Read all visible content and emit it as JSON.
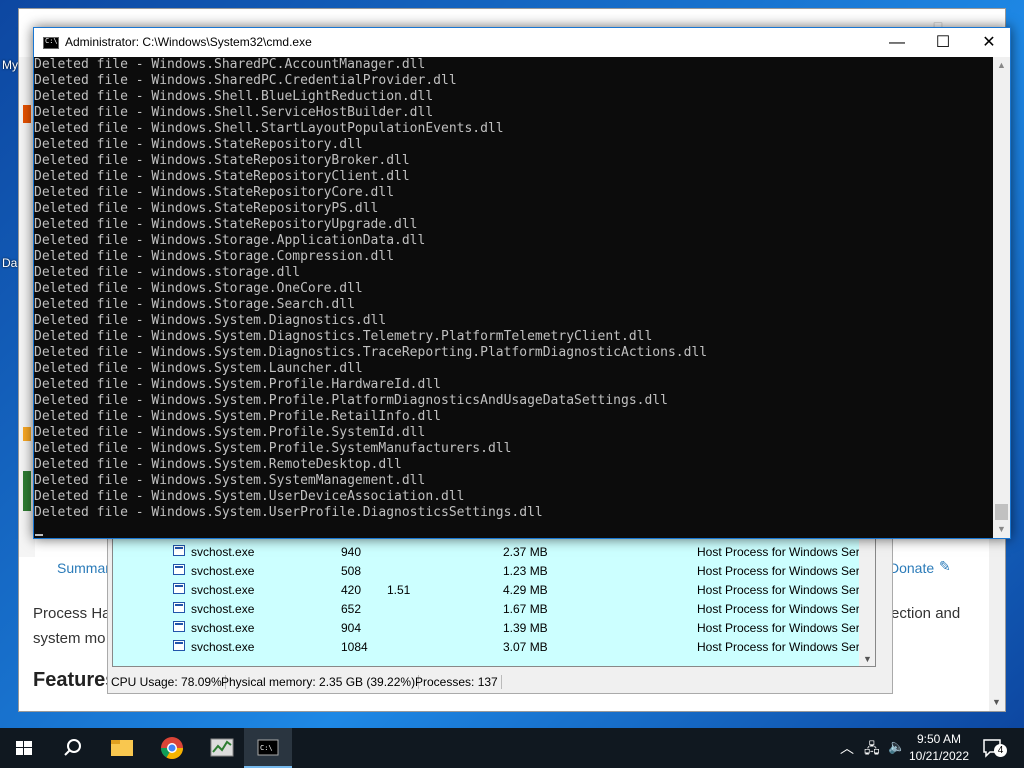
{
  "desktop": {
    "icon_labels": [
      "My",
      "Da"
    ]
  },
  "browser": {
    "summary_link": "Summar",
    "donate_link": "Donate",
    "paragraph_line1": "Process Ha",
    "paragraph_line1_end": "ection and",
    "paragraph_line2": "system mo",
    "features_heading": "Features"
  },
  "cmd": {
    "title": "Administrator:  C:\\Windows\\System32\\cmd.exe",
    "lines": [
      "Deleted file - Windows.SharedPC.AccountManager.dll",
      "Deleted file - Windows.SharedPC.CredentialProvider.dll",
      "Deleted file - Windows.Shell.BlueLightReduction.dll",
      "Deleted file - Windows.Shell.ServiceHostBuilder.dll",
      "Deleted file - Windows.Shell.StartLayoutPopulationEvents.dll",
      "Deleted file - Windows.StateRepository.dll",
      "Deleted file - Windows.StateRepositoryBroker.dll",
      "Deleted file - Windows.StateRepositoryClient.dll",
      "Deleted file - Windows.StateRepositoryCore.dll",
      "Deleted file - Windows.StateRepositoryPS.dll",
      "Deleted file - Windows.StateRepositoryUpgrade.dll",
      "Deleted file - Windows.Storage.ApplicationData.dll",
      "Deleted file - Windows.Storage.Compression.dll",
      "Deleted file - windows.storage.dll",
      "Deleted file - Windows.Storage.OneCore.dll",
      "Deleted file - Windows.Storage.Search.dll",
      "Deleted file - Windows.System.Diagnostics.dll",
      "Deleted file - Windows.System.Diagnostics.Telemetry.PlatformTelemetryClient.dll",
      "Deleted file - Windows.System.Diagnostics.TraceReporting.PlatformDiagnosticActions.dll",
      "Deleted file - Windows.System.Launcher.dll",
      "Deleted file - Windows.System.Profile.HardwareId.dll",
      "Deleted file - Windows.System.Profile.PlatformDiagnosticsAndUsageDataSettings.dll",
      "Deleted file - Windows.System.Profile.RetailInfo.dll",
      "Deleted file - Windows.System.Profile.SystemId.dll",
      "Deleted file - Windows.System.Profile.SystemManufacturers.dll",
      "Deleted file - Windows.System.RemoteDesktop.dll",
      "Deleted file - Windows.System.SystemManagement.dll",
      "Deleted file - Windows.System.UserDeviceAssociation.dll",
      "Deleted file - Windows.System.UserProfile.DiagnosticsSettings.dll"
    ]
  },
  "process_hacker": {
    "rows": [
      {
        "name": "svchost.exe",
        "pid": "940",
        "cpu": "",
        "memory": "2.37 MB",
        "description": "Host Process for Windows Ser..."
      },
      {
        "name": "svchost.exe",
        "pid": "508",
        "cpu": "",
        "memory": "1.23 MB",
        "description": "Host Process for Windows Ser..."
      },
      {
        "name": "svchost.exe",
        "pid": "420",
        "cpu": "1.51",
        "memory": "4.29 MB",
        "description": "Host Process for Windows Ser..."
      },
      {
        "name": "svchost.exe",
        "pid": "652",
        "cpu": "",
        "memory": "1.67 MB",
        "description": "Host Process for Windows Ser..."
      },
      {
        "name": "svchost.exe",
        "pid": "904",
        "cpu": "",
        "memory": "1.39 MB",
        "description": "Host Process for Windows Ser..."
      },
      {
        "name": "svchost.exe",
        "pid": "1084",
        "cpu": "",
        "memory": "3.07 MB",
        "description": "Host Process for Windows Ser..."
      }
    ],
    "status": {
      "cpu_usage": "CPU Usage: 78.09%",
      "physical_memory": "Physical memory: 2.35 GB (39.22%)",
      "processes": "Processes: 137"
    }
  },
  "taskbar": {
    "time": "9:50 AM",
    "date": "10/21/2022",
    "notification_count": "4",
    "apps": [
      "start",
      "search",
      "file-explorer",
      "chrome",
      "task-manager",
      "cmd"
    ]
  },
  "colors": {
    "console_bg": "#0c0c0c",
    "console_fg": "#c0c0c0",
    "process_list_bg": "#ccffff",
    "taskbar_bg": "#101820",
    "accent": "#76b9ed"
  }
}
